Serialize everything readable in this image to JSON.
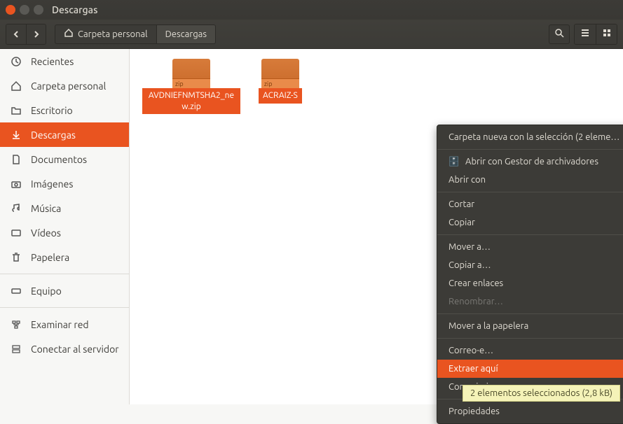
{
  "window": {
    "title": "Descargas"
  },
  "toolbar": {
    "breadcrumbs": [
      {
        "label": "Carpeta personal"
      },
      {
        "label": "Descargas"
      }
    ]
  },
  "sidebar": {
    "items": [
      {
        "label": "Recientes",
        "icon": "clock"
      },
      {
        "label": "Carpeta personal",
        "icon": "home"
      },
      {
        "label": "Escritorio",
        "icon": "folder"
      },
      {
        "label": "Descargas",
        "icon": "download",
        "active": true
      },
      {
        "label": "Documentos",
        "icon": "document"
      },
      {
        "label": "Imágenes",
        "icon": "camera"
      },
      {
        "label": "Música",
        "icon": "music"
      },
      {
        "label": "Vídeos",
        "icon": "video"
      },
      {
        "label": "Papelera",
        "icon": "trash"
      }
    ],
    "devices": [
      {
        "label": "Equipo",
        "icon": "disk"
      }
    ],
    "network": [
      {
        "label": "Examinar red",
        "icon": "network"
      },
      {
        "label": "Conectar al servidor",
        "icon": "server"
      }
    ]
  },
  "files": [
    {
      "name": "AVDNIEFNMTSHA2_new.zip"
    },
    {
      "name": "ACRAIZ-S"
    }
  ],
  "context_menu": {
    "new_folder_selection": "Carpeta nueva con la selección (2 eleme…",
    "open_archive_manager": "Abrir con Gestor de archivadores",
    "open_with": "Abrir con",
    "cut": "Cortar",
    "copy": "Copiar",
    "move_to": "Mover a…",
    "copy_to": "Copiar a…",
    "create_links": "Crear enlaces",
    "rename": "Renombrar…",
    "move_trash": "Mover a la papelera",
    "email": "Correo-e…",
    "extract_here": "Extraer aquí",
    "compress": "Comprimir…",
    "properties": "Propiedades"
  },
  "status": {
    "text": "2 elementos seleccionados  (2,8 kB)"
  }
}
